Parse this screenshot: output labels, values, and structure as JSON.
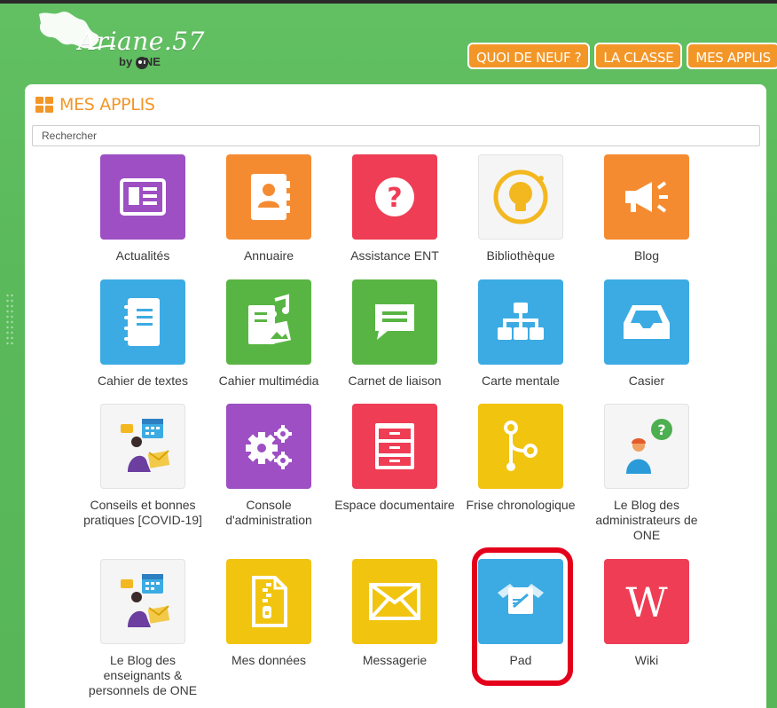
{
  "brand": {
    "name": "Ariane.57",
    "by": "by ONE"
  },
  "nav": {
    "items": [
      "QUOI DE NEUF ?",
      "LA CLASSE",
      "MES APPLIS"
    ]
  },
  "panel": {
    "title": "MES APPLIS",
    "search_placeholder": "Rechercher"
  },
  "apps": [
    {
      "label": "Actualités",
      "icon": "newspaper-icon",
      "color": "#9d4fc3"
    },
    {
      "label": "Annuaire",
      "icon": "address-book-icon",
      "color": "#f58b31"
    },
    {
      "label": "Assistance ENT",
      "icon": "question-icon",
      "color": "#ef3d55"
    },
    {
      "label": "Bibliothèque",
      "icon": "lightbulb-icon",
      "color": "#f5f5f5"
    },
    {
      "label": "Blog",
      "icon": "megaphone-icon",
      "color": "#f58b31"
    },
    {
      "label": "Cahier de textes",
      "icon": "notebook-icon",
      "color": "#3cabe3"
    },
    {
      "label": "Cahier multimédia",
      "icon": "multimedia-icon",
      "color": "#59b543"
    },
    {
      "label": "Carnet de liaison",
      "icon": "chat-bubble-icon",
      "color": "#59b543"
    },
    {
      "label": "Carte mentale",
      "icon": "sitemap-icon",
      "color": "#3cabe3"
    },
    {
      "label": "Casier",
      "icon": "inbox-icon",
      "color": "#3cabe3"
    },
    {
      "label": "Conseils et bonnes pratiques [COVID-19]",
      "icon": "person-calendar-icon",
      "color": "#f5f5f5"
    },
    {
      "label": "Console d'administration",
      "icon": "gears-icon",
      "color": "#9d4fc3"
    },
    {
      "label": "Espace documentaire",
      "icon": "drawers-icon",
      "color": "#ef3d55"
    },
    {
      "label": "Frise chronologique",
      "icon": "timeline-icon",
      "color": "#f1c40f"
    },
    {
      "label": "Le Blog des administrateurs de ONE",
      "icon": "person-question-icon",
      "color": "#f5f5f5"
    },
    {
      "label": "Le Blog des enseignants & personnels de ONE",
      "icon": "person-calendar-icon",
      "color": "#f5f5f5"
    },
    {
      "label": "Mes données",
      "icon": "zip-file-icon",
      "color": "#f1c40f"
    },
    {
      "label": "Messagerie",
      "icon": "envelope-icon",
      "color": "#f1c40f"
    },
    {
      "label": "Pad",
      "icon": "pad-icon",
      "color": "#3cabe3"
    },
    {
      "label": "Wiki",
      "icon": "wikipedia-icon",
      "color": "#ef3d55"
    }
  ]
}
